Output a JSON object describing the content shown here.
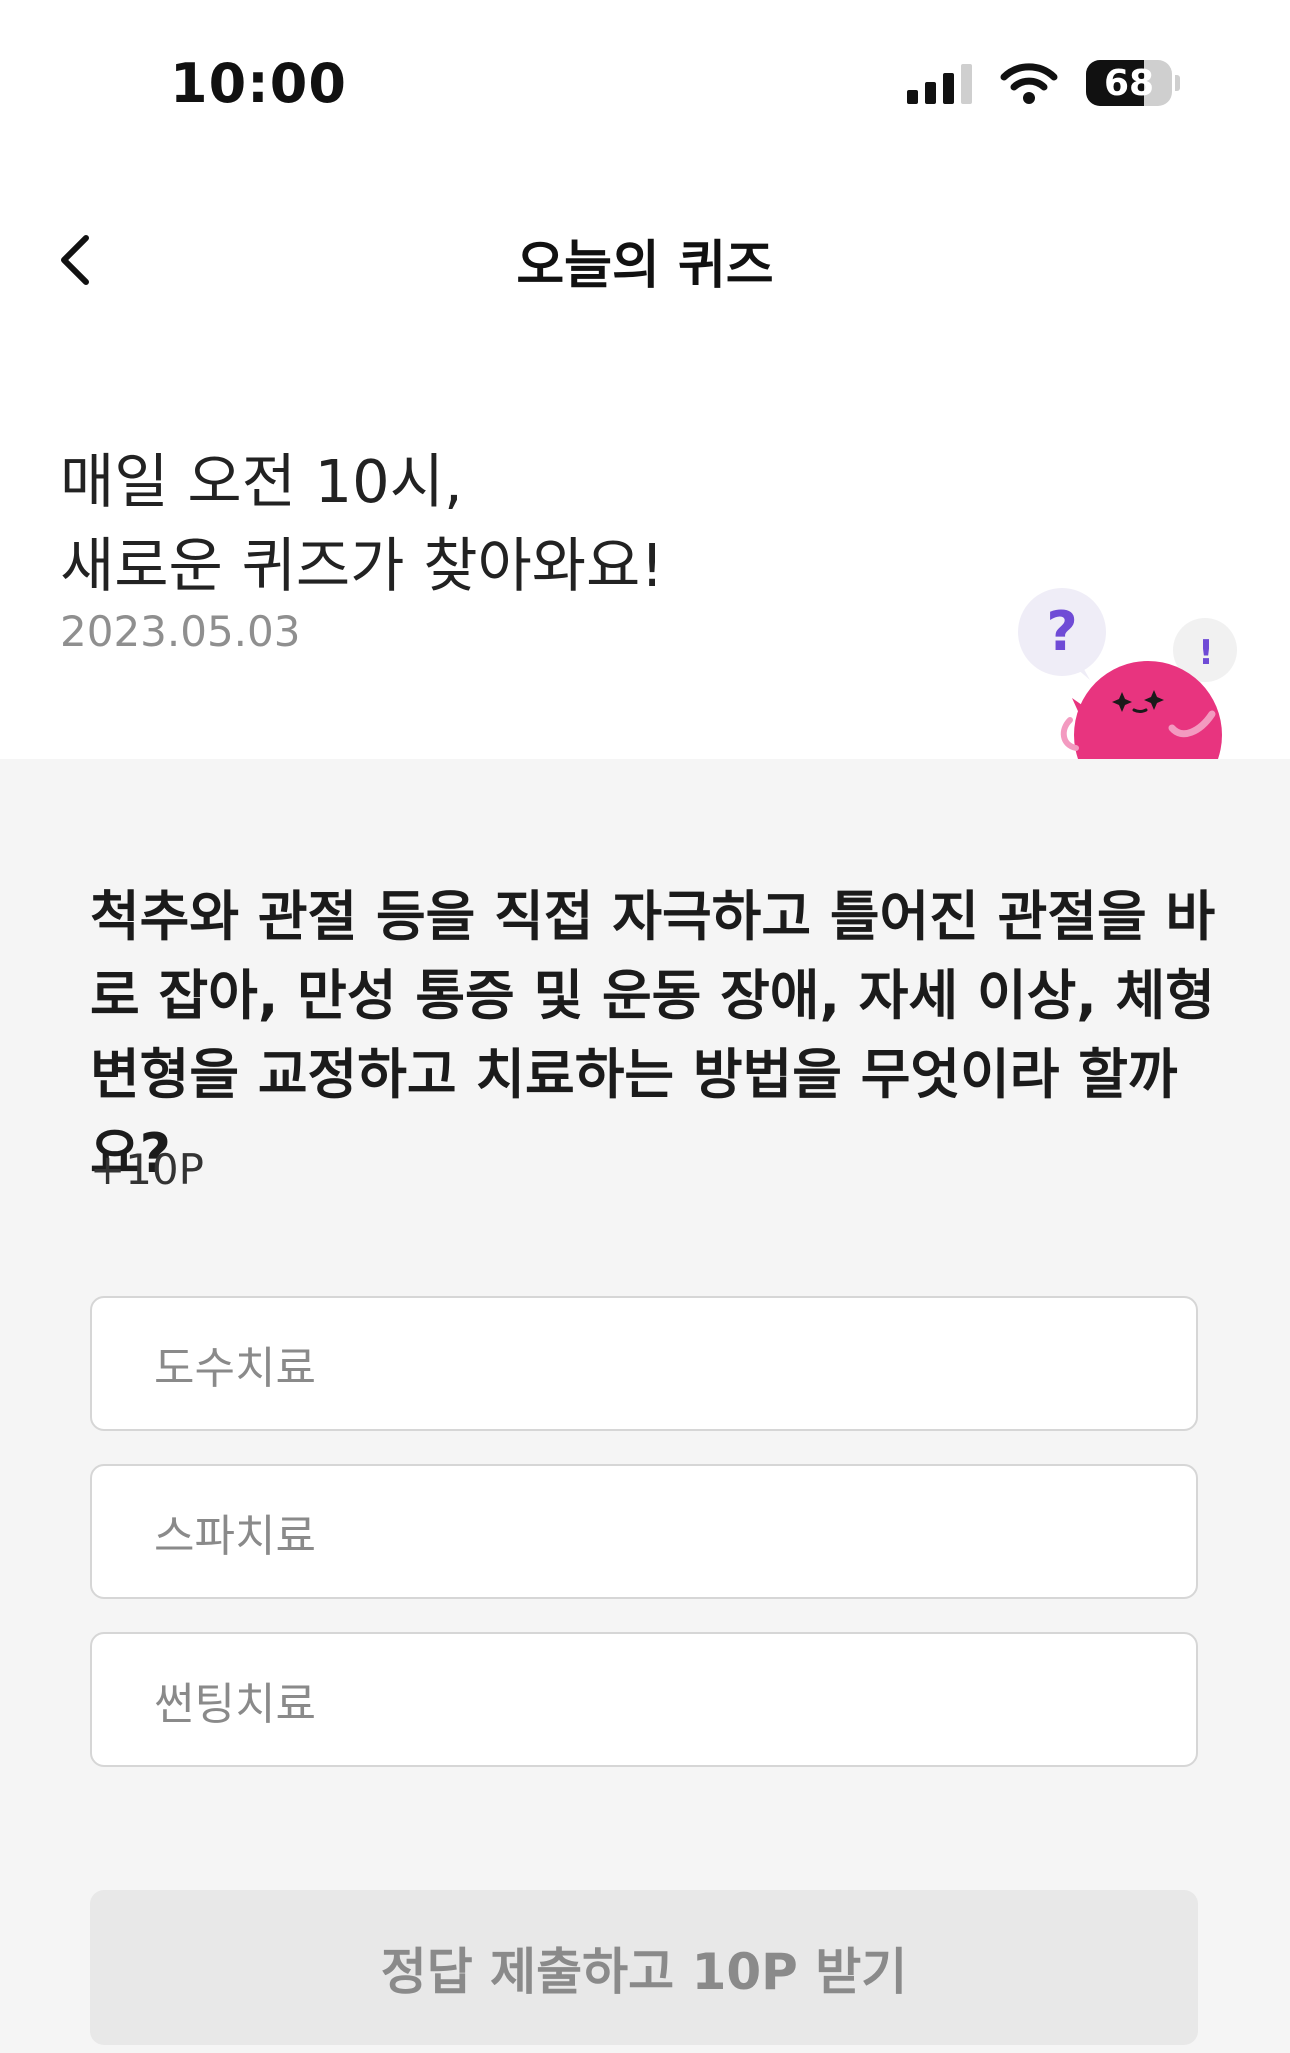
{
  "status_bar": {
    "time": "10:00",
    "battery": "68",
    "battery_level": 0.68
  },
  "nav": {
    "title": "오늘의 퀴즈",
    "back_icon": "chevron-left-icon"
  },
  "hero": {
    "line1": "매일 오전 10시,",
    "line2": "새로운 퀴즈가 찾아와요!",
    "date": "2023.05.03",
    "mascot_question_mark": "?",
    "mascot_exclamation": "!"
  },
  "quiz": {
    "question": "척추와 관절 등을 직접 자극하고 틀어진 관절을 바로 잡아, 만성 통증 및 운동 장애, 자세 이상, 체형 변형을 교정하고 치료하는 방법을 무엇이라 할까요?",
    "points": "+10P",
    "options": [
      "도수치료",
      "스파치료",
      "썬팅치료"
    ],
    "submit_label": "정답 제출하고 10P 받기"
  },
  "colors": {
    "mascot": "#e8347f",
    "question_mark": "#6f4bd6",
    "section_bg": "#f5f5f5",
    "submit_bg": "#e8e8e8"
  }
}
